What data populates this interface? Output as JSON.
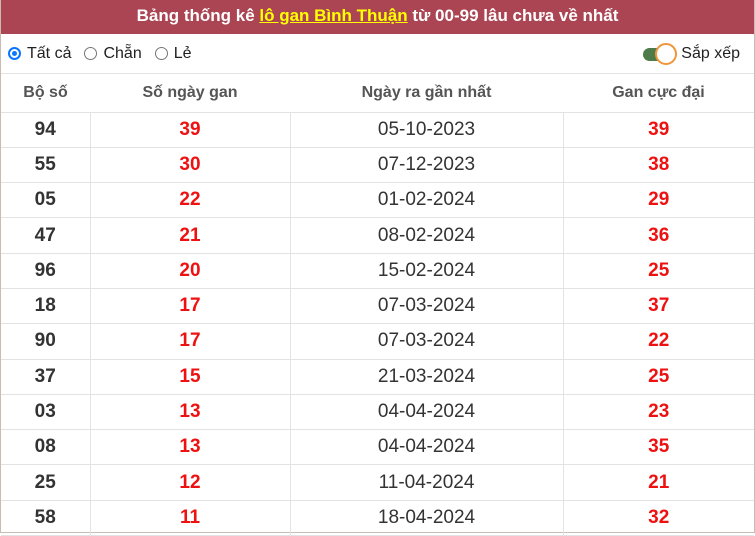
{
  "header": {
    "title_prefix": "Bảng thống kê ",
    "title_highlight": "lô gan Bình Thuận",
    "title_suffix": " từ 00-99 lâu chưa về nhất"
  },
  "filters": {
    "options": [
      {
        "label": "Tất cả",
        "checked": true
      },
      {
        "label": "Chẵn",
        "checked": false
      },
      {
        "label": "Lẻ",
        "checked": false
      }
    ],
    "sort_label": "Sắp xếp",
    "sort_enabled": true
  },
  "colors": {
    "header_bg": "#ab4553",
    "highlight": "#ffff00",
    "value_red": "#ee1111",
    "toggle_track": "#4d7c4a",
    "toggle_knob_border": "#f0963a",
    "radio_checked": "#0a75ff"
  },
  "table": {
    "columns": [
      "Bộ số",
      "Số ngày gan",
      "Ngày ra gần nhất",
      "Gan cực đại"
    ],
    "rows": [
      {
        "number": "94",
        "days": "39",
        "last_date": "05-10-2023",
        "max_gan": "39"
      },
      {
        "number": "55",
        "days": "30",
        "last_date": "07-12-2023",
        "max_gan": "38"
      },
      {
        "number": "05",
        "days": "22",
        "last_date": "01-02-2024",
        "max_gan": "29"
      },
      {
        "number": "47",
        "days": "21",
        "last_date": "08-02-2024",
        "max_gan": "36"
      },
      {
        "number": "96",
        "days": "20",
        "last_date": "15-02-2024",
        "max_gan": "25"
      },
      {
        "number": "18",
        "days": "17",
        "last_date": "07-03-2024",
        "max_gan": "37"
      },
      {
        "number": "90",
        "days": "17",
        "last_date": "07-03-2024",
        "max_gan": "22"
      },
      {
        "number": "37",
        "days": "15",
        "last_date": "21-03-2024",
        "max_gan": "25"
      },
      {
        "number": "03",
        "days": "13",
        "last_date": "04-04-2024",
        "max_gan": "23"
      },
      {
        "number": "08",
        "days": "13",
        "last_date": "04-04-2024",
        "max_gan": "35"
      },
      {
        "number": "25",
        "days": "12",
        "last_date": "11-04-2024",
        "max_gan": "21"
      },
      {
        "number": "58",
        "days": "11",
        "last_date": "18-04-2024",
        "max_gan": "32"
      }
    ]
  }
}
